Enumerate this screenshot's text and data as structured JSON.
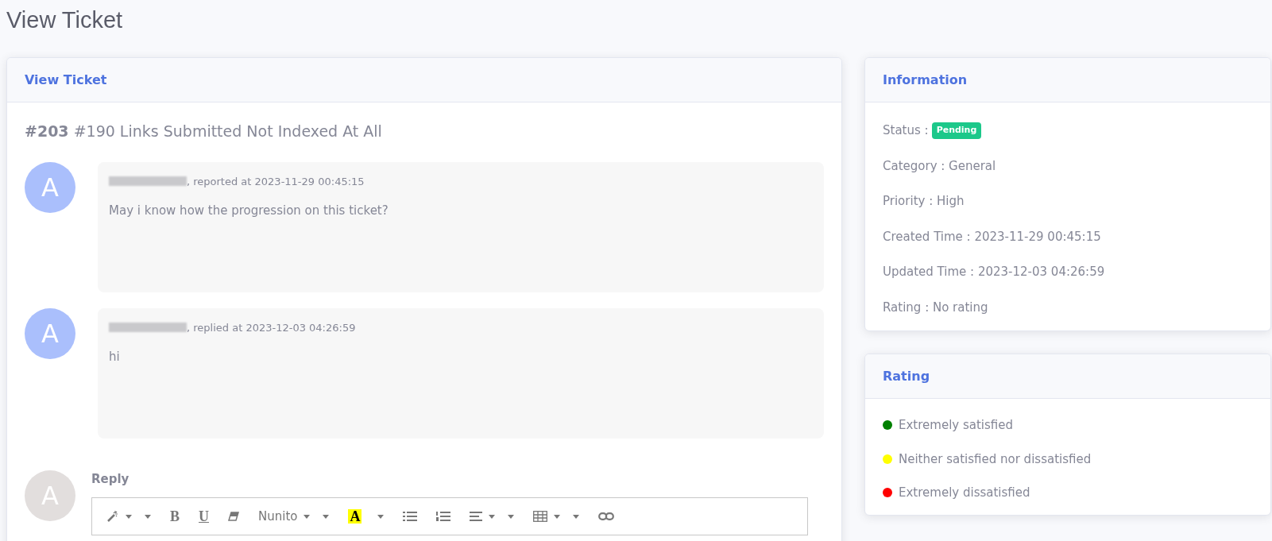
{
  "page_title": "View Ticket",
  "ticket_card": {
    "header": "View Ticket",
    "number": "#203",
    "subject": "#190 Links Submitted Not Indexed At All",
    "messages": [
      {
        "avatar": "A",
        "meta": ", reported at 2023-11-29 00:45:15",
        "body": "May i know how the progression on this ticket?"
      },
      {
        "avatar": "A",
        "meta": ", replied at 2023-12-03 04:26:59",
        "body": "hi"
      }
    ],
    "reply": {
      "avatar": "A",
      "label": "Reply",
      "toolbar": [
        {
          "kind": "wand"
        },
        {
          "kind": "bold",
          "label": "B"
        },
        {
          "kind": "underline",
          "label": "U"
        },
        {
          "kind": "eraser"
        },
        {
          "kind": "font",
          "label": "Nunito"
        },
        {
          "kind": "highlight",
          "label": "A"
        },
        {
          "kind": "ul"
        },
        {
          "kind": "ol"
        },
        {
          "kind": "align"
        },
        {
          "kind": "table"
        },
        {
          "kind": "link"
        }
      ]
    }
  },
  "information": {
    "header": "Information",
    "status_label": "Status :",
    "status": "Pending",
    "rows": [
      "Category : General",
      "Priority : High",
      "Created Time : 2023-11-29 00:45:15",
      "Updated Time : 2023-12-03 04:26:59",
      "Rating : No rating"
    ]
  },
  "rating": {
    "header": "Rating",
    "options": [
      {
        "label": "Extremely satisfied",
        "color": "#008000"
      },
      {
        "label": "Neither satisfied nor dissatisfied",
        "color": "#ffff00"
      },
      {
        "label": "Extremely dissatisfied",
        "color": "#ff0000"
      }
    ]
  }
}
